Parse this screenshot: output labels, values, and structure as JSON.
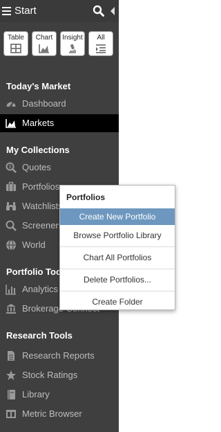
{
  "topbar": {
    "title": "Start"
  },
  "view_buttons": [
    {
      "label": "Table"
    },
    {
      "label": "Chart"
    },
    {
      "label": "Insight"
    },
    {
      "label": "All"
    }
  ],
  "sections": {
    "todays_market": "Today's Market",
    "my_collections": "My Collections",
    "portfolio_tools": "Portfolio Tools",
    "research_tools": "Research Tools"
  },
  "items": {
    "dashboard": "Dashboard",
    "markets": "Markets",
    "quotes": "Quotes",
    "portfolios": "Portfolios",
    "watchlists": "Watchlists",
    "screeners": "Screeners",
    "world": "World",
    "analytics": "Analytics",
    "brokerage": "Brokerage Connect",
    "research_reports": "Research Reports",
    "stock_ratings": "Stock Ratings",
    "library": "Library",
    "metric_browser": "Metric Browser"
  },
  "popup": {
    "title": "Portfolios",
    "items": [
      "Create New Portfolio",
      "Browse Portfolio Library",
      "Chart All Portfolios",
      "Delete Portfolios...",
      "Create Folder"
    ]
  }
}
